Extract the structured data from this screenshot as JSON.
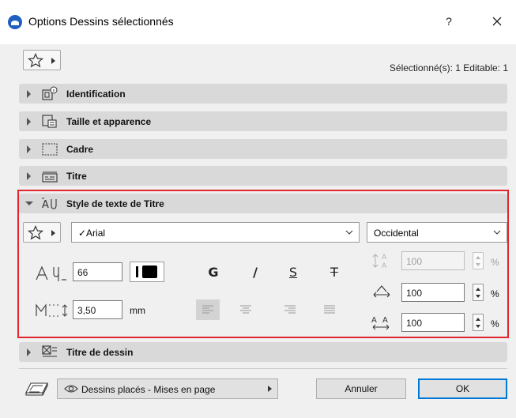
{
  "window": {
    "title": "Options Dessins sélectionnés",
    "help_label": "?"
  },
  "selection_info": "Sélectionné(s): 1 Editable: 1",
  "panels": [
    {
      "label": "Identification",
      "icon": "identification-icon",
      "expanded": false
    },
    {
      "label": "Taille et apparence",
      "icon": "size-appearance-icon",
      "expanded": false
    },
    {
      "label": "Cadre",
      "icon": "frame-icon",
      "expanded": false
    },
    {
      "label": "Titre",
      "icon": "title-icon",
      "expanded": false
    },
    {
      "label": "Style de texte de Titre",
      "icon": "text-style-icon",
      "expanded": true
    },
    {
      "label": "Titre de dessin",
      "icon": "drawing-title-icon",
      "expanded": false
    }
  ],
  "text_style": {
    "font": "✓Arial",
    "script": "Occidental",
    "font_size": "66",
    "pen_color": "#000000",
    "bold_label": "G",
    "italic_label": "/",
    "underline_label": "S",
    "strikethrough_label": "T",
    "line_spacing": "3,50",
    "line_spacing_unit": "mm",
    "alignment": "left",
    "char_spacing": "100",
    "char_spacing_unit": "%",
    "width_factor": "100",
    "width_factor_unit": "%",
    "char_height": "100",
    "char_height_unit": "%"
  },
  "footer": {
    "views_label": "Dessins placés - Mises en page",
    "cancel_label": "Annuler",
    "ok_label": "OK"
  },
  "colors": {
    "highlight_frame": "#e0262e",
    "default_button_border": "#0078d7"
  }
}
